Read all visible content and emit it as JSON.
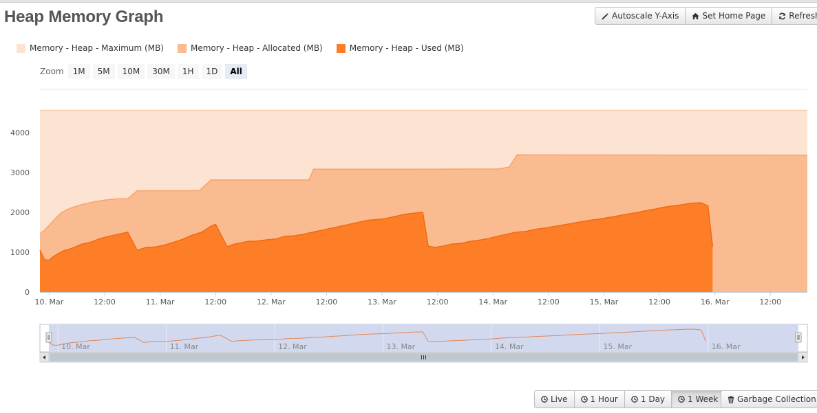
{
  "page": {
    "title": "Heap Memory Graph"
  },
  "toolbar": {
    "autoscale_label": "Autoscale Y-Axis",
    "home_label": "Set Home Page",
    "refresh_label": "Refresh"
  },
  "legend": {
    "maximum": "Memory - Heap - Maximum (MB)",
    "allocated": "Memory - Heap - Allocated (MB)",
    "used": "Memory - Heap - Used (MB)"
  },
  "zoom": {
    "label": "Zoom",
    "options": [
      "1M",
      "5M",
      "10M",
      "30M",
      "1H",
      "1D",
      "All"
    ],
    "selected": "All"
  },
  "range_buttons": {
    "live": "Live",
    "hour": "1 Hour",
    "day": "1 Day",
    "week": "1 Week",
    "selected": "1 Week"
  },
  "gc_label": "Garbage Collection",
  "colors": {
    "maximum": "#fde3d2",
    "allocated": "#fbbb91",
    "used": "#fd7e26",
    "navigator_bg": "#d2d9ee",
    "navigator_line": "#e0865a"
  },
  "icons": {
    "autoscale": "magic-wand-icon",
    "home": "home-icon",
    "refresh": "refresh-icon",
    "clock": "clock-icon",
    "trash": "trash-icon"
  },
  "chart_data": {
    "type": "area",
    "x_axis": {
      "unit": "hours since 9. Mar 12:00",
      "range": [
        10.0,
        176.0
      ],
      "tick_labels": [
        "10. Mar",
        "12:00",
        "11. Mar",
        "12:00",
        "12. Mar",
        "12:00",
        "13. Mar",
        "12:00",
        "14. Mar",
        "12:00",
        "15. Mar",
        "12:00",
        "16. Mar",
        "12:00"
      ]
    },
    "y_axis": {
      "range": [
        0,
        4600
      ],
      "ticks": [
        0,
        1000,
        2000,
        3000,
        4000
      ]
    },
    "grid": true,
    "legend_position": "top-left",
    "series": [
      {
        "name": "Memory - Heap - Maximum (MB)",
        "points": [
          [
            10,
            4555
          ],
          [
            176,
            4555
          ]
        ]
      },
      {
        "name": "Memory - Heap - Allocated (MB)",
        "points": [
          [
            10,
            1460
          ],
          [
            11,
            1550
          ],
          [
            13,
            1800
          ],
          [
            14.5,
            1980
          ],
          [
            16.5,
            2100
          ],
          [
            19,
            2190
          ],
          [
            22,
            2270
          ],
          [
            25,
            2320
          ],
          [
            27,
            2340
          ],
          [
            29,
            2340
          ],
          [
            31,
            2540
          ],
          [
            42,
            2540
          ],
          [
            44.5,
            2545
          ],
          [
            47,
            2810
          ],
          [
            68.2,
            2810
          ],
          [
            69.2,
            3080
          ],
          [
            91,
            3080
          ],
          [
            109,
            3085
          ],
          [
            111.5,
            3130
          ],
          [
            113.2,
            3440
          ],
          [
            176,
            3430
          ]
        ]
      },
      {
        "name": "Memory - Heap - Used (MB)",
        "points": [
          [
            10,
            1050
          ],
          [
            11,
            810
          ],
          [
            12,
            800
          ],
          [
            13,
            900
          ],
          [
            15,
            1030
          ],
          [
            17,
            1100
          ],
          [
            19,
            1200
          ],
          [
            21,
            1250
          ],
          [
            23,
            1340
          ],
          [
            25,
            1400
          ],
          [
            27,
            1450
          ],
          [
            29,
            1500
          ],
          [
            31,
            1050
          ],
          [
            33,
            1120
          ],
          [
            35,
            1130
          ],
          [
            37,
            1180
          ],
          [
            39,
            1250
          ],
          [
            41,
            1330
          ],
          [
            43,
            1430
          ],
          [
            45,
            1500
          ],
          [
            47,
            1650
          ],
          [
            48,
            1700
          ],
          [
            50.5,
            1140
          ],
          [
            52,
            1200
          ],
          [
            55,
            1270
          ],
          [
            57,
            1280
          ],
          [
            59,
            1310
          ],
          [
            61,
            1330
          ],
          [
            63,
            1400
          ],
          [
            65,
            1410
          ],
          [
            67,
            1450
          ],
          [
            69,
            1500
          ],
          [
            71,
            1550
          ],
          [
            73,
            1600
          ],
          [
            75,
            1650
          ],
          [
            77,
            1700
          ],
          [
            79,
            1750
          ],
          [
            81,
            1800
          ],
          [
            83,
            1820
          ],
          [
            85,
            1850
          ],
          [
            87,
            1900
          ],
          [
            89,
            1950
          ],
          [
            91,
            1980
          ],
          [
            92.8,
            2000
          ],
          [
            94,
            1150
          ],
          [
            95.5,
            1120
          ],
          [
            97,
            1150
          ],
          [
            99,
            1200
          ],
          [
            101,
            1220
          ],
          [
            103,
            1270
          ],
          [
            105,
            1300
          ],
          [
            107,
            1340
          ],
          [
            109,
            1400
          ],
          [
            111,
            1450
          ],
          [
            113,
            1500
          ],
          [
            115,
            1520
          ],
          [
            117,
            1570
          ],
          [
            119,
            1600
          ],
          [
            121,
            1640
          ],
          [
            123,
            1680
          ],
          [
            125,
            1720
          ],
          [
            127,
            1760
          ],
          [
            129,
            1800
          ],
          [
            131,
            1830
          ],
          [
            133,
            1870
          ],
          [
            135,
            1910
          ],
          [
            137,
            1950
          ],
          [
            139,
            1990
          ],
          [
            141,
            2040
          ],
          [
            143,
            2080
          ],
          [
            145,
            2130
          ],
          [
            147,
            2160
          ],
          [
            149,
            2190
          ],
          [
            151,
            2230
          ],
          [
            153,
            2240
          ],
          [
            154.5,
            2160
          ],
          [
            155.5,
            1140
          ]
        ]
      }
    ]
  }
}
